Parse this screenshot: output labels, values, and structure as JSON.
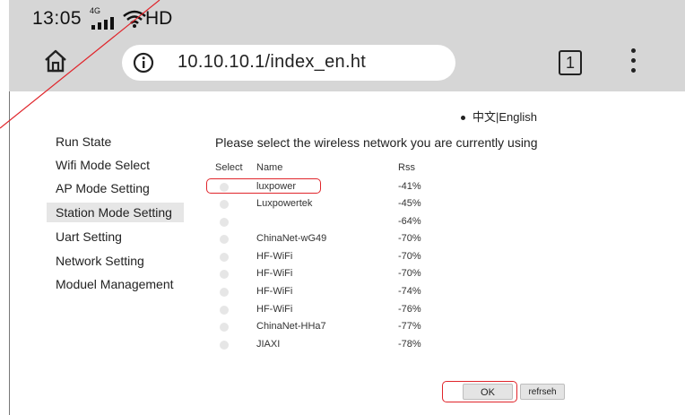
{
  "status_bar": {
    "time": "13:05",
    "network_type": "4G",
    "hd_label": "HD"
  },
  "browser": {
    "url": "10.10.10.1/index_en.ht",
    "tab_count": "1"
  },
  "page": {
    "language_switch": "中文|English",
    "heading": "Please select the  wireless network you are currently using",
    "nav": [
      {
        "label": "Run State",
        "active": false
      },
      {
        "label": "Wifi Mode Select",
        "active": false
      },
      {
        "label": "AP Mode Setting",
        "active": false
      },
      {
        "label": "Station Mode Setting",
        "active": true
      },
      {
        "label": "Uart Setting",
        "active": false
      },
      {
        "label": "Network Setting",
        "active": false
      },
      {
        "label": "Moduel Management",
        "active": false
      }
    ],
    "table": {
      "headers": {
        "select": "Select",
        "name": "Name",
        "rss": "Rss"
      },
      "rows": [
        {
          "name": "luxpower",
          "rss": "-41%"
        },
        {
          "name": "Luxpowertek",
          "rss": "-45%"
        },
        {
          "name": "",
          "rss": "-64%"
        },
        {
          "name": "ChinaNet-wG49",
          "rss": "-70%"
        },
        {
          "name": "HF-WiFi",
          "rss": "-70%"
        },
        {
          "name": "HF-WiFi",
          "rss": "-70%"
        },
        {
          "name": "HF-WiFi",
          "rss": "-74%"
        },
        {
          "name": "HF-WiFi",
          "rss": "-76%"
        },
        {
          "name": "ChinaNet-HHa7",
          "rss": "-77%"
        },
        {
          "name": "JIAXI",
          "rss": "-78%"
        }
      ]
    },
    "buttons": {
      "ok": "OK",
      "refresh": "refrseh"
    }
  },
  "colors": {
    "annotation_red": "#e0252b",
    "chrome_gray": "#d6d6d6"
  }
}
